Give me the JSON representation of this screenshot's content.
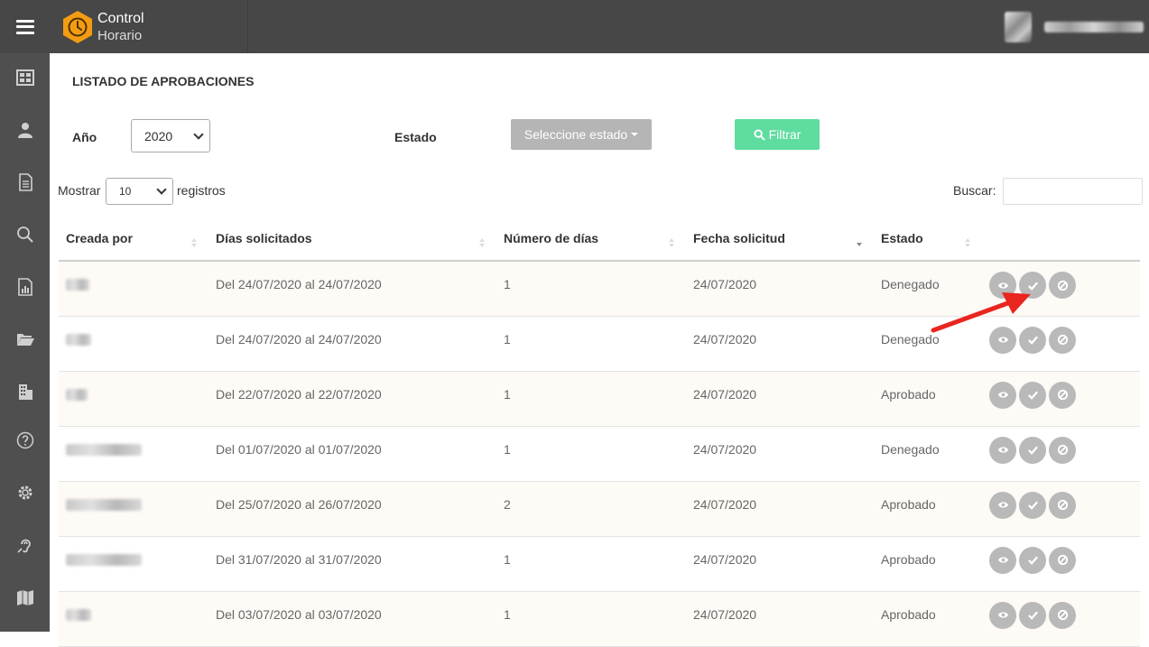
{
  "brand": {
    "line1": "Control",
    "line2": "Horario",
    "accent": "#f39c12"
  },
  "sidebar": {
    "items": [
      {
        "icon": "dashboard-icon"
      },
      {
        "icon": "user-icon"
      },
      {
        "icon": "document-icon"
      },
      {
        "icon": "search-icon"
      },
      {
        "icon": "report-icon"
      },
      {
        "icon": "folder-icon"
      },
      {
        "icon": "building-icon"
      },
      {
        "icon": "help-icon"
      },
      {
        "icon": "gear-icon"
      },
      {
        "icon": "hearing-icon"
      },
      {
        "icon": "map-icon"
      }
    ]
  },
  "page": {
    "title": "LISTADO DE APROBACIONES"
  },
  "filters": {
    "year_label": "Año",
    "year_value": "2020",
    "estado_label": "Estado",
    "estado_button": "Seleccione estado",
    "filter_button": "Filtrar"
  },
  "table_controls": {
    "show_label": "Mostrar",
    "show_value": "10",
    "records_label": "registros",
    "search_label": "Buscar:"
  },
  "table": {
    "columns": [
      "Creada por",
      "Días solicitados",
      "Número de días",
      "Fecha solicitud",
      "Estado"
    ],
    "rows": [
      {
        "dias": "Del 24/07/2020 al 24/07/2020",
        "numero": "1",
        "fecha": "24/07/2020",
        "estado": "Denegado"
      },
      {
        "dias": "Del 24/07/2020 al 24/07/2020",
        "numero": "1",
        "fecha": "24/07/2020",
        "estado": "Denegado"
      },
      {
        "dias": "Del 22/07/2020 al 22/07/2020",
        "numero": "1",
        "fecha": "24/07/2020",
        "estado": "Aprobado"
      },
      {
        "dias": "Del 01/07/2020 al 01/07/2020",
        "numero": "1",
        "fecha": "24/07/2020",
        "estado": "Denegado"
      },
      {
        "dias": "Del 25/07/2020 al 26/07/2020",
        "numero": "2",
        "fecha": "24/07/2020",
        "estado": "Aprobado"
      },
      {
        "dias": "Del 31/07/2020 al 31/07/2020",
        "numero": "1",
        "fecha": "24/07/2020",
        "estado": "Aprobado"
      },
      {
        "dias": "Del 03/07/2020 al 03/07/2020",
        "numero": "1",
        "fecha": "24/07/2020",
        "estado": "Aprobado"
      }
    ]
  },
  "colors": {
    "filter_button": "#5fdca0",
    "estado_button": "#b5b5b5",
    "topbar": "#474747",
    "sidebar": "#4f4f4f",
    "arrow": "#e8261f"
  }
}
